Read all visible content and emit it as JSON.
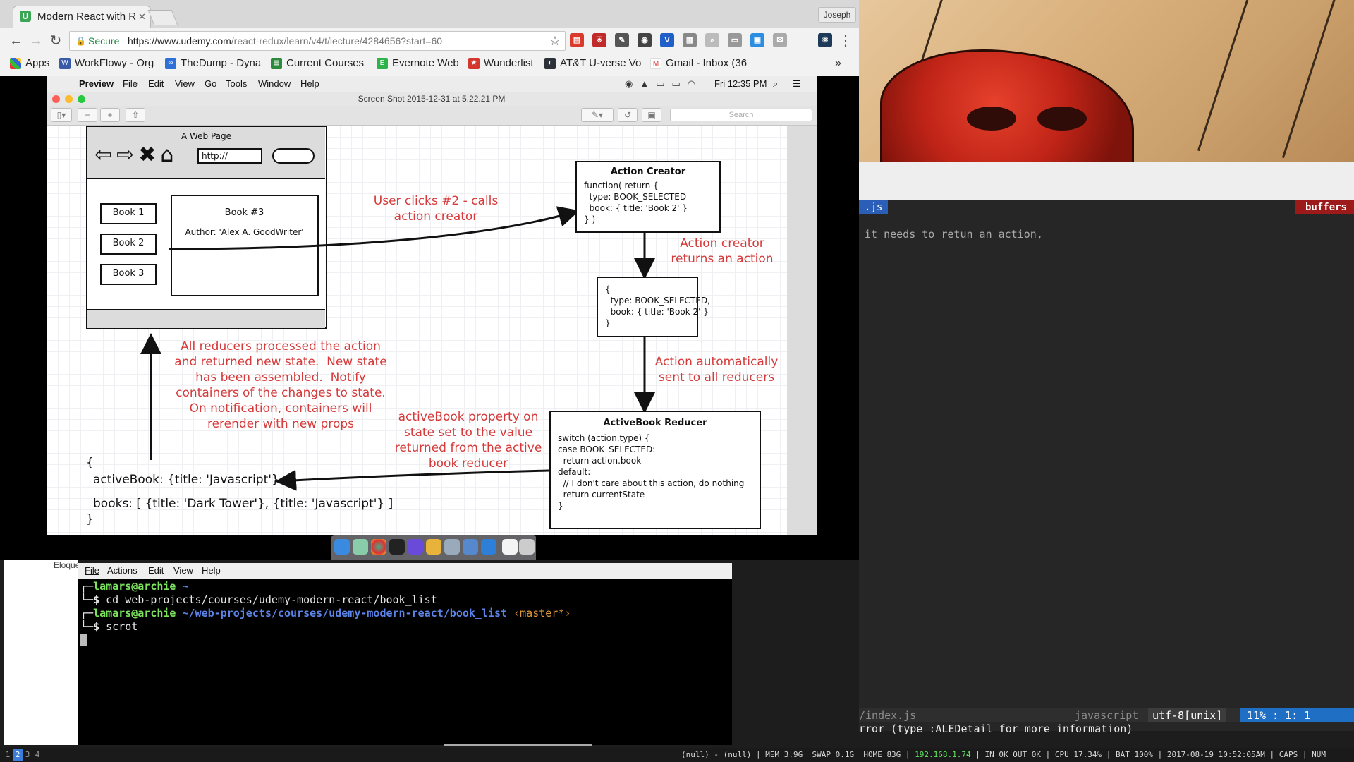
{
  "browser": {
    "tab_title": "Modern React with R",
    "profile": "Joseph",
    "secure_label": "Secure",
    "url_host": "https://www.udemy.com",
    "url_path": "/react-redux/learn/v4/t/lecture/4284656?start=60",
    "bookmarks": [
      "Apps",
      "WorkFlowy - Org",
      "TheDump - Dyna",
      "Current Courses",
      "Evernote Web",
      "Wunderlist",
      "AT&T U-verse Vo",
      "Gmail - Inbox (36"
    ],
    "bookmarks_more": "»"
  },
  "mac": {
    "menu": [
      "Preview",
      "File",
      "Edit",
      "View",
      "Go",
      "Tools",
      "Window",
      "Help"
    ],
    "clock": "Fri 12:35 PM",
    "window_title": "Screen Shot 2015-12-31 at 5.22.21 PM",
    "search_placeholder": "Search"
  },
  "diagram": {
    "webpage_title": "A Web Page",
    "url_field": "http://",
    "books": [
      "Book 1",
      "Book 2",
      "Book 3"
    ],
    "detail_title": "Book #3",
    "detail_author": "Author: 'Alex A. GoodWriter'",
    "note_clicks": "User clicks #2 - calls\naction creator",
    "action_creator_title": "Action Creator",
    "action_creator_code": "function( return {\n  type: BOOK_SELECTED\n  book: { title: 'Book 2' }\n} )",
    "note_returns": "Action creator\nreturns an action",
    "action_code": "{\n  type: BOOK_SELECTED,\n  book: { title: 'Book 2' }\n}",
    "note_sent": "Action automatically\nsent to all reducers",
    "reducer_title": "ActiveBook Reducer",
    "reducer_code": "switch (action.type) {\ncase BOOK_SELECTED:\n  return action.book\ndefault:\n  // I don't care about this action, do nothing\n  return currentState\n}",
    "note_property": "activeBook property on\nstate set to the value\nreturned from the active\nbook reducer",
    "note_reducers": "All reducers processed the action\nand returned new state.  New state\nhas been assembled.  Notify\ncontainers of the changes to state.\nOn notification, containers will\nrerender with new props",
    "state_open": "{",
    "state_active": "activeBook: {title: 'Javascript'}",
    "state_books": "books: [ {title: 'Dark Tower'}, {title: 'Javascript'} ]",
    "state_close": "}"
  },
  "terminal": {
    "behind_label": "Eloque",
    "menu": [
      "File",
      "Actions",
      "Edit",
      "View",
      "Help"
    ],
    "lines": [
      {
        "user": "lamars@archie",
        "path": "~",
        "git": ""
      },
      {
        "cmd": "cd web-projects/courses/udemy-modern-react/book_list"
      },
      {
        "user": "lamars@archie",
        "path": "~/web-projects/courses/udemy-modern-react/book_list",
        "git": "‹master*›"
      },
      {
        "cmd": "scrot"
      }
    ]
  },
  "editor": {
    "tab_label": ".js",
    "buffers_label": "buffers",
    "content_line": "it needs to retun an action,",
    "status_file": "/index.js",
    "status_lang": "javascript",
    "status_encoding": "utf-8[unix]",
    "status_pos": "11% :   1:  1",
    "message": "rror (type :ALEDetail for more information)"
  },
  "statusbar": {
    "workspaces": [
      "1",
      "2",
      "3",
      "4"
    ],
    "active_workspace": "2",
    "stats_pre": "(null) - (null) | MEM 3.9G  SWAP 0.1G  HOME 83G | ",
    "ip": "192.168.1.74",
    "stats_post": " | IN 0K OUT 0K | CPU 17.34% | BAT 100% | 2017-08-19 10:52:05AM | CAPS | NUM"
  }
}
